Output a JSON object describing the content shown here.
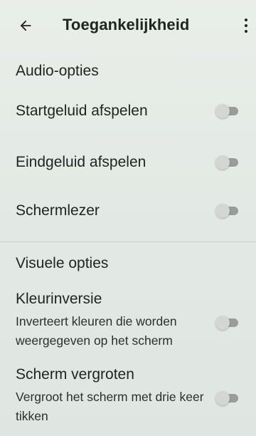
{
  "appbar": {
    "title": "Toegankelijkheid",
    "back_icon": "arrow-left-icon",
    "more_icon": "more-vert-icon"
  },
  "audio": {
    "header": "Audio-opties",
    "items": [
      {
        "title": "Startgeluid afspelen",
        "checked": false
      },
      {
        "title": "Eindgeluid afspelen",
        "checked": false
      },
      {
        "title": "Schermlezer",
        "checked": false
      }
    ]
  },
  "visual": {
    "header": "Visuele opties",
    "items": [
      {
        "title": "Kleurinversie",
        "summary": "Inverteert kleuren die worden weergegeven op het scherm",
        "checked": false
      },
      {
        "title": "Scherm vergroten",
        "summary": "Vergroot het scherm met drie keer tikken",
        "checked": false
      }
    ]
  },
  "colors": {
    "background": "#e6ebe6",
    "text": "#1f2420",
    "switch_off_track": "#8b8f8c",
    "switch_off_thumb": "#d3d6d3"
  }
}
